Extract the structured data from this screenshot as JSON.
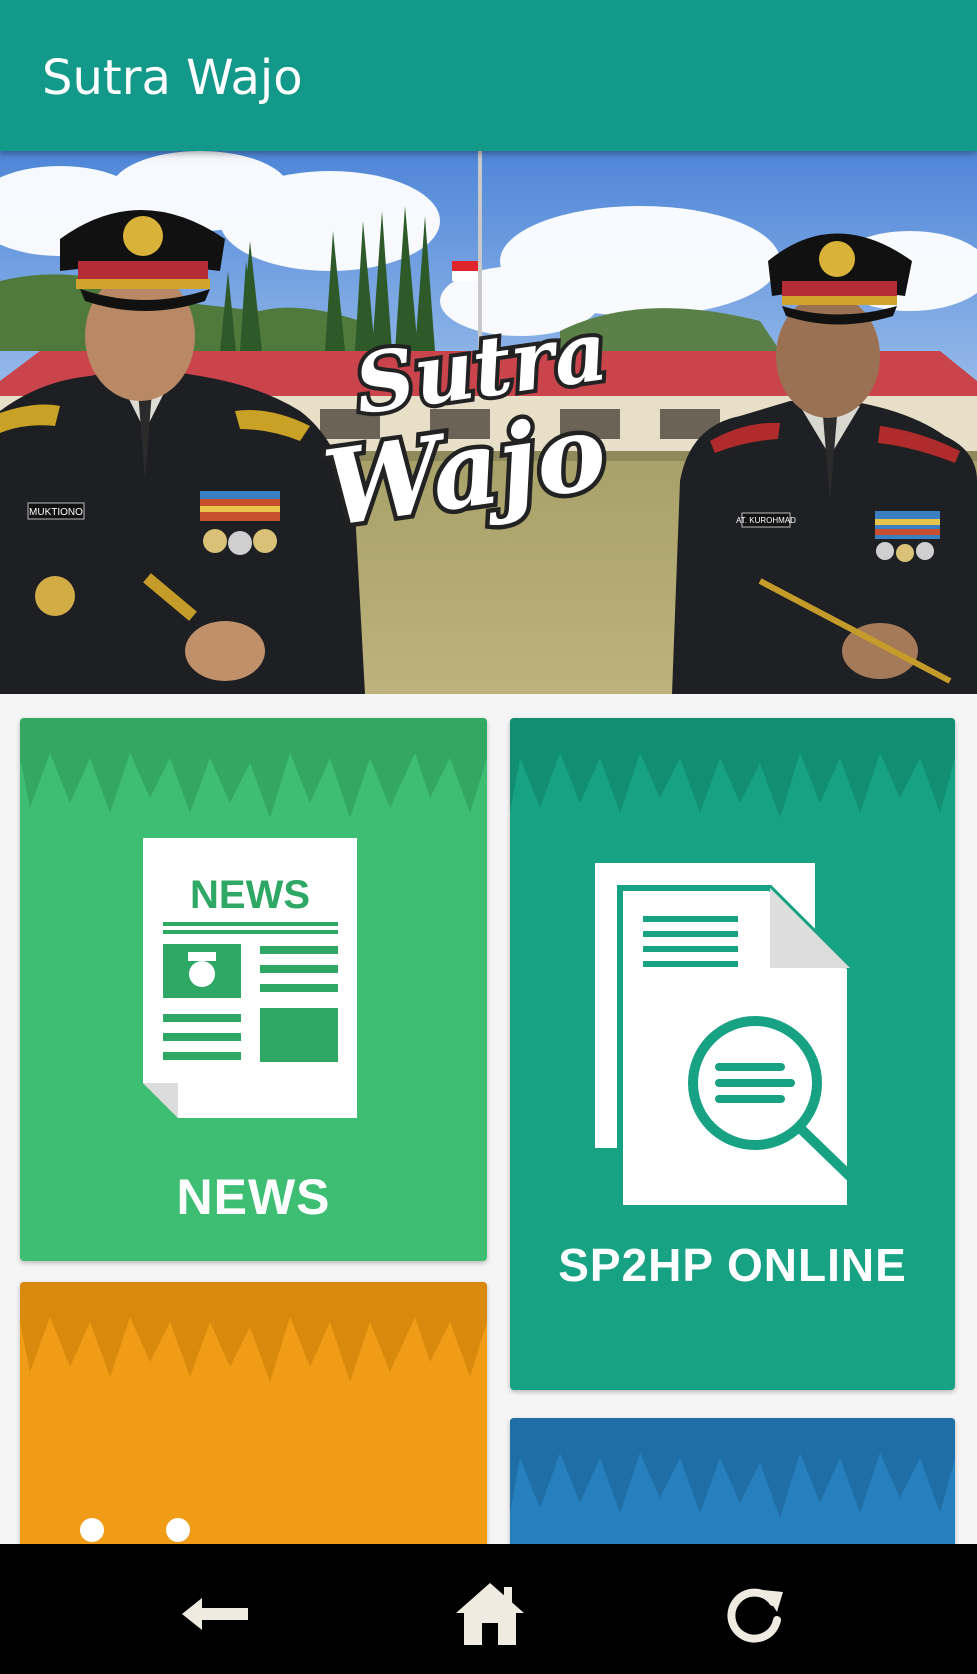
{
  "appbar": {
    "title": "Sutra Wajo"
  },
  "banner": {
    "logo_line1": "Sutra",
    "logo_line2": "Wajo",
    "name_tag_left": "MUKTIONO",
    "name_tag_right": "AT. KUROHMAD"
  },
  "cards": {
    "news": {
      "label": "NEWS",
      "icon_text": "NEWS",
      "color": "#3dbe72"
    },
    "sp2hp": {
      "label": "SP2HP ONLINE",
      "color": "#17a283"
    },
    "third": {
      "color": "#f09c17"
    },
    "fourth": {
      "color": "#2680bd"
    }
  },
  "navbar": {
    "back_icon": "back-arrow-icon",
    "home_icon": "home-icon",
    "refresh_icon": "refresh-icon"
  }
}
